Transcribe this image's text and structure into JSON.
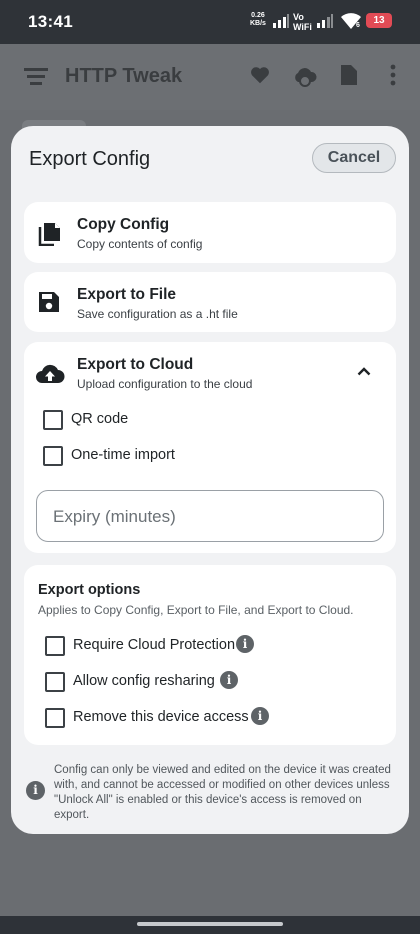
{
  "status_bar": {
    "time": "13:41",
    "net_speed_value": "0.26",
    "net_speed_unit": "KB/s",
    "volte_top": "Vo",
    "volte_bottom": "WiFi",
    "wifi_sub": "6",
    "battery": "13"
  },
  "app_bar": {
    "title": "HTTP Tweak",
    "icons": [
      "menu-icon",
      "heart-icon",
      "cloud-sync-icon",
      "file-icon",
      "more-vert-icon"
    ]
  },
  "dialog": {
    "title": "Export Config",
    "cancel_label": "Cancel",
    "copy": {
      "title": "Copy Config",
      "subtitle": "Copy contents of config",
      "icon": "copy-icon"
    },
    "file": {
      "title": "Export to File",
      "subtitle": "Save configuration as a .ht file",
      "icon": "save-icon"
    },
    "cloud": {
      "title": "Export to Cloud",
      "subtitle": "Upload configuration to the cloud",
      "icon": "cloud-upload-icon",
      "expanded": true,
      "qr_label": "QR code",
      "qr_checked": false,
      "onetime_label": "One-time import",
      "onetime_checked": false,
      "expiry_placeholder": "Expiry (minutes)",
      "expiry_value": ""
    },
    "options": {
      "title": "Export options",
      "subtitle": "Applies to Copy Config, Export to File, and Export to Cloud.",
      "items": [
        {
          "label": "Require Cloud Protection",
          "checked": false
        },
        {
          "label": "Allow config resharing",
          "checked": false
        },
        {
          "label": "Remove this device access",
          "checked": false
        }
      ]
    },
    "footer_note": "Config can only be viewed and edited on the device it was created with, and cannot be accessed or modified on other devices unless \"Unlock All\" is enabled or this device's access is removed on export.",
    "info_glyph": "i"
  }
}
